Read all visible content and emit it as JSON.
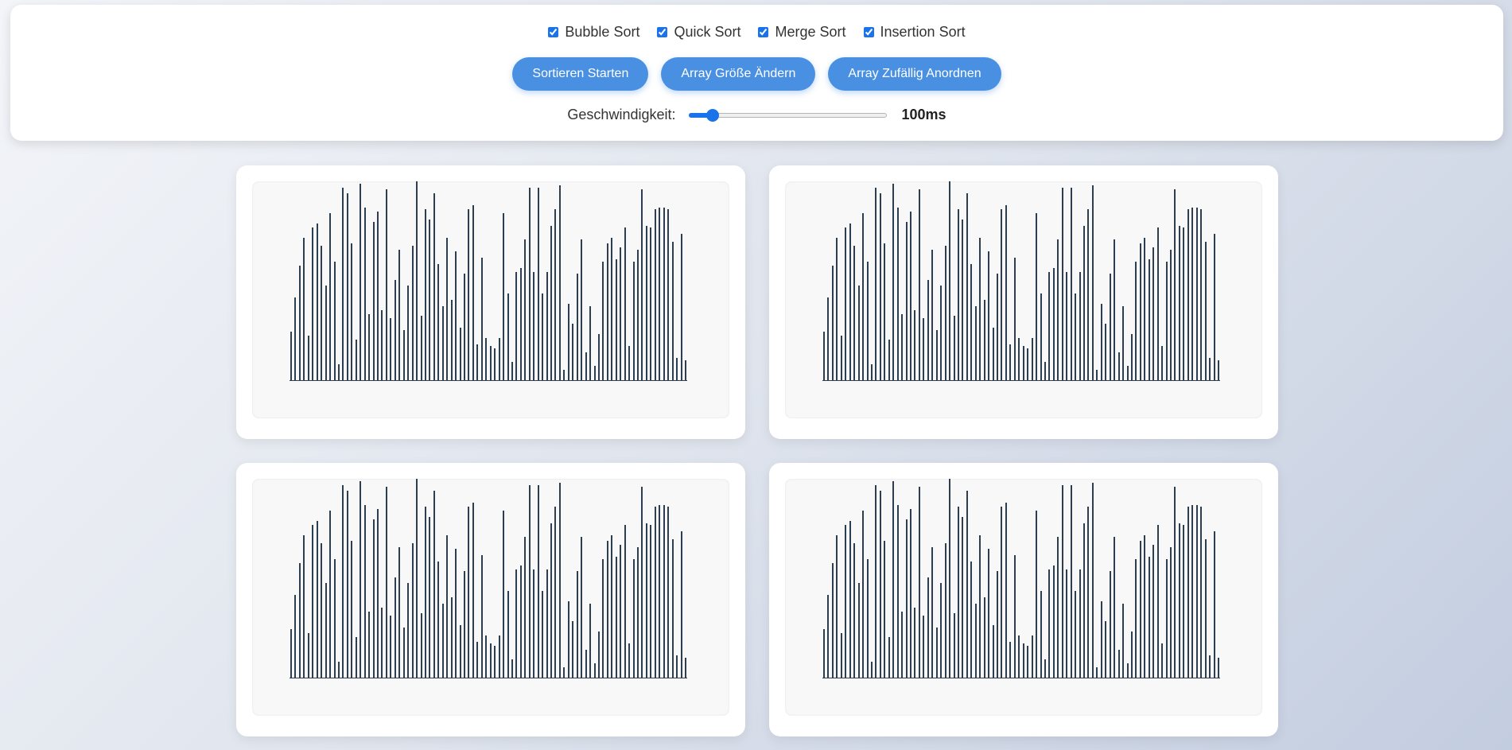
{
  "algorithms": [
    {
      "label": "Bubble Sort",
      "checked": true
    },
    {
      "label": "Quick Sort",
      "checked": true
    },
    {
      "label": "Merge Sort",
      "checked": true
    },
    {
      "label": "Insertion Sort",
      "checked": true
    }
  ],
  "buttons": {
    "start": "Sortieren Starten",
    "resize": "Array Größe Ändern",
    "shuffle": "Array Zufällig Anordnen"
  },
  "speed": {
    "label": "Geschwindigkeit:",
    "value_text": "100ms",
    "fraction": 0.12
  },
  "colors": {
    "accent": "#4a90e2",
    "bar": "#2c3e50",
    "checkbox": "#1a73e8"
  },
  "array": [
    24,
    41,
    57,
    71,
    22,
    76,
    78,
    67,
    47,
    83,
    59,
    8,
    96,
    93,
    68,
    20,
    98,
    86,
    33,
    79,
    84,
    35,
    95,
    31,
    50,
    65,
    25,
    47,
    67,
    99,
    32,
    85,
    80,
    93,
    58,
    37,
    71,
    40,
    64,
    26,
    53,
    85,
    87,
    18,
    61,
    21,
    17,
    16,
    21,
    83,
    43,
    9,
    54,
    56,
    70,
    96,
    54,
    96,
    43,
    54,
    77,
    85,
    97,
    5,
    38,
    28,
    53,
    70,
    14,
    37,
    7,
    23,
    59,
    68,
    71,
    60,
    66,
    76,
    17,
    59,
    65,
    95,
    77,
    76,
    85,
    86,
    86,
    85,
    69,
    11,
    73,
    10
  ]
}
